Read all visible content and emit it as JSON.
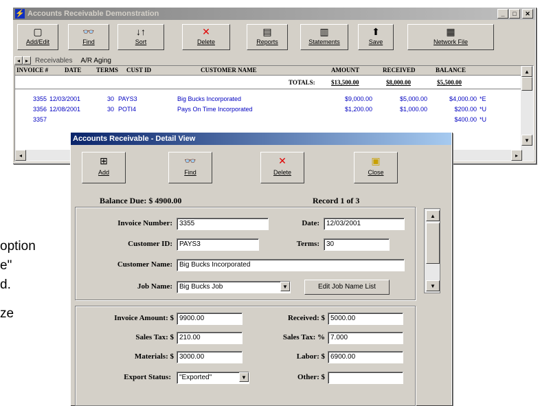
{
  "main_window": {
    "title": "Accounts Receivable Demonstration",
    "toolbar": [
      {
        "label": "Add/Edit",
        "icon": "add-edit-icon",
        "glyph": "▢"
      },
      {
        "label": "Find",
        "icon": "binoculars-icon",
        "glyph": "👓"
      },
      {
        "label": "Sort",
        "icon": "sort-icon",
        "glyph": "↓↑"
      },
      {
        "label": "Delete",
        "icon": "delete-x-icon",
        "glyph": "✕"
      },
      {
        "label": "Reports",
        "icon": "reports-icon",
        "glyph": "▤"
      },
      {
        "label": "Statements",
        "icon": "statements-icon",
        "glyph": "▥"
      },
      {
        "label": "Save",
        "icon": "save-icon",
        "glyph": "⬆"
      },
      {
        "label": "Network File",
        "icon": "network-icon",
        "glyph": "▦"
      }
    ],
    "tabs": [
      "Receivables",
      "A/R Aging"
    ],
    "columns": [
      "INVOICE #",
      "DATE",
      "TERMS",
      "CUST ID",
      "CUSTOMER NAME",
      "AMOUNT",
      "RECEIVED",
      "BALANCE"
    ],
    "totals": {
      "label": "TOTALS:",
      "amount": "$13,500.00",
      "received": "$8,000.00",
      "balance": "$5,500.00"
    },
    "rows": [
      {
        "invoice": "3355",
        "date": "12/03/2001",
        "terms": "30",
        "cust_id": "PAYS3",
        "name": "Big Bucks Incorporated",
        "amount": "$9,000.00",
        "received": "$5,000.00",
        "balance": "$4,000.00",
        "extra": "*E"
      },
      {
        "invoice": "3356",
        "date": "12/08/2001",
        "terms": "30",
        "cust_id": "POTI4",
        "name": "Pays On Time Incorporated",
        "amount": "$1,200.00",
        "received": "$1,000.00",
        "balance": "$200.00",
        "extra": "*U"
      },
      {
        "invoice": "3357",
        "date": "",
        "terms": "",
        "cust_id": "",
        "name": "",
        "amount": "",
        "received": "",
        "balance": "$400.00",
        "extra": "*U"
      }
    ]
  },
  "left_text": [
    "option",
    "e\"",
    "d.",
    "ze"
  ],
  "detail": {
    "title": "Accounts Receivable - Detail View",
    "buttons": [
      {
        "label": "Add",
        "icon": "add-icon",
        "glyph": "⊞"
      },
      {
        "label": "Find",
        "icon": "binoculars-icon",
        "glyph": "👓"
      },
      {
        "label": "Delete",
        "icon": "delete-x-icon",
        "glyph": "✕"
      },
      {
        "label": "Close",
        "icon": "close-folder-icon",
        "glyph": "▣"
      }
    ],
    "balance_due": "Balance Due: $ 4900.00",
    "record": "Record 1 of 3",
    "fields": {
      "invoice_number_label": "Invoice Number:",
      "invoice_number": "3355",
      "date_label": "Date:",
      "date": "12/03/2001",
      "customer_id_label": "Customer ID:",
      "customer_id": "PAYS3",
      "terms_label": "Terms:",
      "terms": "30",
      "customer_name_label": "Customer Name:",
      "customer_name": "Big Bucks Incorporated",
      "job_name_label": "Job Name:",
      "job_name": "Big Bucks Job",
      "edit_job_button": "Edit Job Name List",
      "invoice_amount_label": "Invoice Amount: $",
      "invoice_amount": "9900.00",
      "received_label": "Received: $",
      "received": "5000.00",
      "sales_tax_label": "Sales Tax: $",
      "sales_tax": "210.00",
      "sales_tax_pct_label": "Sales Tax: %",
      "sales_tax_pct": "7.000",
      "materials_label": "Materials: $",
      "materials": "3000.00",
      "labor_label": "Labor: $",
      "labor": "6900.00",
      "export_status_label": "Export Status:",
      "export_status": "\"Exported\"",
      "other_label": "Other: $",
      "other": ""
    }
  }
}
